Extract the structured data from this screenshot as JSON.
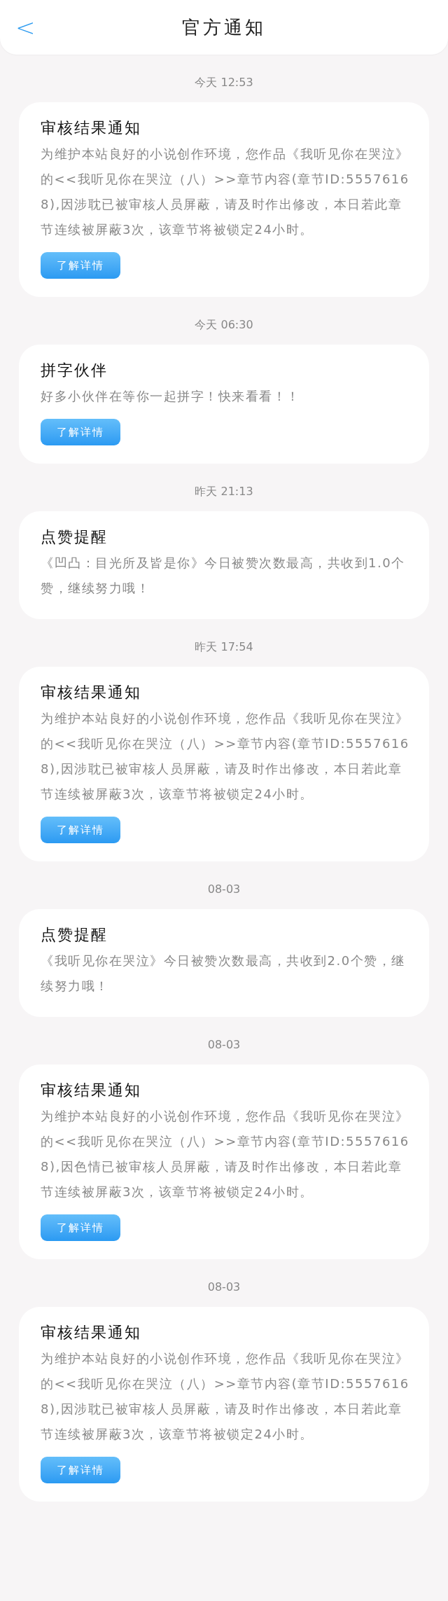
{
  "header": {
    "back": "<",
    "title": "官方通知"
  },
  "notices": [
    {
      "time": "今天 12:53",
      "title": "审核结果通知",
      "body": "为维护本站良好的小说创作环境，您作品《我听见你在哭泣》的<<我听见你在哭泣（八）>>章节内容(章节ID:55576168),因涉耽已被审核人员屏蔽，请及时作出修改，本日若此章节连续被屏蔽3次，该章节将被锁定24小时。",
      "button": "了解详情"
    },
    {
      "time": "今天 06:30",
      "title": "拼字伙伴",
      "body": "好多小伙伴在等你一起拼字！快来看看！！",
      "button": "了解详情"
    },
    {
      "time": "昨天 21:13",
      "title": "点赞提醒",
      "body": "《凹凸：目光所及皆是你》今日被赞次数最高，共收到1.0个赞，继续努力哦！"
    },
    {
      "time": "昨天 17:54",
      "title": "审核结果通知",
      "body": "为维护本站良好的小说创作环境，您作品《我听见你在哭泣》的<<我听见你在哭泣（八）>>章节内容(章节ID:55576168),因涉耽已被审核人员屏蔽，请及时作出修改，本日若此章节连续被屏蔽3次，该章节将被锁定24小时。",
      "button": "了解详情"
    },
    {
      "time": "08-03",
      "title": "点赞提醒",
      "body": "《我听见你在哭泣》今日被赞次数最高，共收到2.0个赞，继续努力哦！"
    },
    {
      "time": "08-03",
      "title": "审核结果通知",
      "body": "为维护本站良好的小说创作环境，您作品《我听见你在哭泣》的<<我听见你在哭泣（八）>>章节内容(章节ID:55576168),因色情已被审核人员屏蔽，请及时作出修改，本日若此章节连续被屏蔽3次，该章节将被锁定24小时。",
      "button": "了解详情"
    },
    {
      "time": "08-03",
      "title": "审核结果通知",
      "body": "为维护本站良好的小说创作环境，您作品《我听见你在哭泣》的<<我听见你在哭泣（八）>>章节内容(章节ID:55576168),因涉耽已被审核人员屏蔽，请及时作出修改，本日若此章节连续被屏蔽3次，该章节将被锁定24小时。",
      "button": "了解详情"
    }
  ]
}
